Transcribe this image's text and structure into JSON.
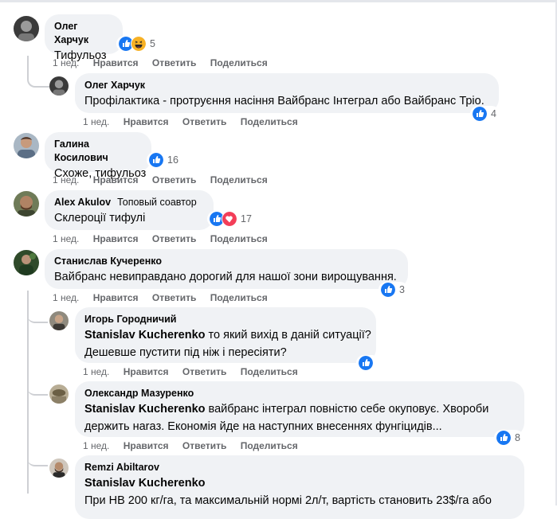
{
  "comments": [
    {
      "author": "Олег Харчук",
      "text": "Тифульоз",
      "reaction_icons": [
        "like-icon",
        "haha-icon"
      ],
      "reaction_count": "5",
      "time": "1 нед.",
      "like": "Нравится",
      "reply": "Ответить",
      "share": "Поделиться"
    },
    {
      "author": "Олег Харчук",
      "text": "Профілактика - протруєння насіння Вайбранс Інтеграл або Вайбранс Тріо.",
      "reaction_icons": [
        "like-icon"
      ],
      "reaction_count": "4",
      "time": "1 нед.",
      "like": "Нравится",
      "reply": "Ответить",
      "share": "Поделиться"
    },
    {
      "author": "Галина Косилович",
      "text": "Схоже, тифульоз",
      "reaction_icons": [
        "like-icon"
      ],
      "reaction_count": "16",
      "time": "1 нед.",
      "like": "Нравится",
      "reply": "Ответить",
      "share": "Поделиться"
    },
    {
      "author": "Alex Akulov",
      "badge": "Топовый соавтор",
      "text": "Склероції тифулі",
      "reaction_icons": [
        "like-icon",
        "love-icon"
      ],
      "reaction_count": "17",
      "time": "1 нед.",
      "like": "Нравится",
      "reply": "Ответить",
      "share": "Поделиться"
    },
    {
      "author": "Станислав Кучеренко",
      "text": "Вайбранс невиправдано дорогий для нашої зони вирощування.",
      "reaction_icons": [
        "like-icon"
      ],
      "reaction_count": "3",
      "time": "1 нед.",
      "like": "Нравится",
      "reply": "Ответить",
      "share": "Поделиться"
    },
    {
      "author": "Игорь Городничий",
      "mention": "Stanislav Kucherenko",
      "text_line1": " то який вихід в даній ситуації?",
      "text_line2": "Дешевше пустити під ніж і пересіяти?",
      "reaction_icons": [
        "like-icon"
      ],
      "reaction_count": "",
      "time": "1 нед.",
      "like": "Нравится",
      "reply": "Ответить",
      "share": "Поделиться"
    },
    {
      "author": "Олександр Мазуренко",
      "mention": "Stanislav Kucherenko",
      "text_line1": " вайбранс інтеграл повністю себе окуповує. Хвороби",
      "text_line2": "держить наraз. Економія йде на наступних внесеннях фунгіцидів...",
      "reaction_icons": [
        "like-icon"
      ],
      "reaction_count": "8",
      "time": "1 нед.",
      "like": "Нравится",
      "reply": "Ответить",
      "share": "Поделиться"
    },
    {
      "author": "Remzi Abiltarov",
      "mention": "Stanislav Kucherenko",
      "text_line2": "При НВ 200 кг/га, та максимальній нормі 2л/т, вартість становить 23$/га або"
    }
  ],
  "colors": {
    "bubble": "#f0f2f5",
    "meta": "#65676b",
    "like_blue": "#1877f2",
    "love_red": "#f33e58",
    "haha_yellow": "#f7b125"
  }
}
